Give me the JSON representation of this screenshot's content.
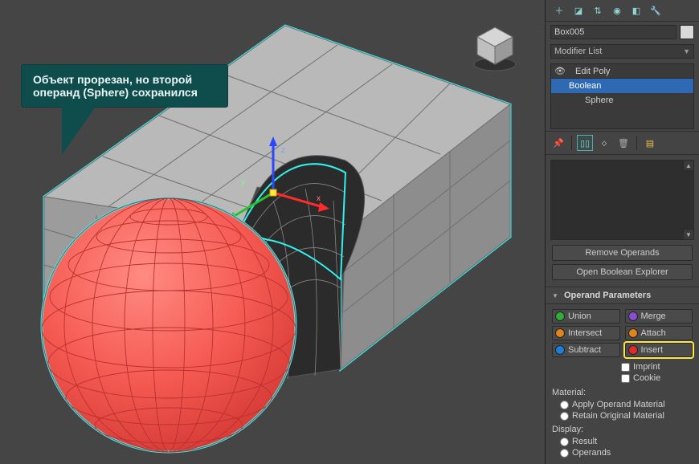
{
  "callout_text": "Объект прорезан, но второй операнд (Sphere) сохранился",
  "object_name": "Box005",
  "modifier_list_placeholder": "Modifier List",
  "stack": {
    "header_eye": "👁",
    "items": [
      {
        "label": "Edit Poly",
        "has_children": true,
        "selected": false
      },
      {
        "label": "Boolean",
        "has_children": false,
        "selected": true
      },
      {
        "label": "Sphere",
        "has_children": false,
        "selected": false,
        "level2": true
      }
    ]
  },
  "buttons": {
    "remove_operands": "Remove Operands",
    "open_explorer": "Open Boolean Explorer"
  },
  "operand_params_header": "Operand Parameters",
  "ops": {
    "union": "Union",
    "merge": "Merge",
    "intersect": "Intersect",
    "attach": "Attach",
    "subtract": "Subtract",
    "insert": "Insert"
  },
  "checks": {
    "imprint": "Imprint",
    "cookie": "Cookie"
  },
  "material_group": "Material:",
  "material": {
    "apply": "Apply Operand Material",
    "retain": "Retain Original Material"
  },
  "display_group": "Display:",
  "display": {
    "result": "Result",
    "operands": "Operands"
  },
  "icons": {
    "plus": "＋",
    "sel": "☐",
    "link": "⎘",
    "motion": "◉",
    "disp": "☀",
    "util": "⚙",
    "pin": "📌",
    "lock": "🔒",
    "stack": "▥",
    "trash": "🗑",
    "cfg": "✎"
  }
}
